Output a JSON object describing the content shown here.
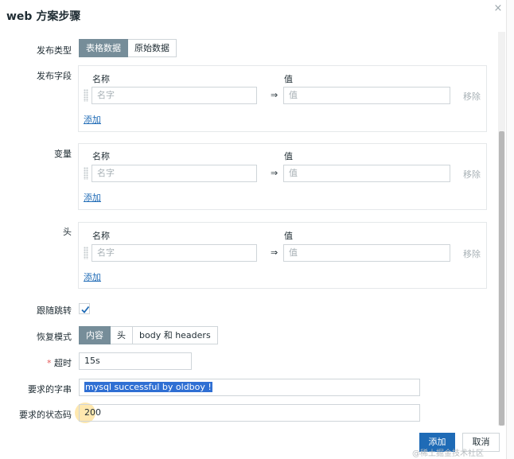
{
  "dialog": {
    "title": "web 方案步骤",
    "close_glyph": "×"
  },
  "post_type": {
    "label": "发布类型",
    "options": [
      "表格数据",
      "原始数据"
    ],
    "selected": "表格数据"
  },
  "post_fields": {
    "label": "发布字段",
    "name_header": "名称",
    "value_header": "值",
    "rows": [
      {
        "name_placeholder": "名字",
        "value_placeholder": "值",
        "arrow": "⇒",
        "remove": "移除"
      }
    ],
    "add": "添加"
  },
  "variables": {
    "label": "变量",
    "name_header": "名称",
    "value_header": "值",
    "rows": [
      {
        "name_placeholder": "名字",
        "value_placeholder": "值",
        "arrow": "⇒",
        "remove": "移除"
      }
    ],
    "add": "添加"
  },
  "headers": {
    "label": "头",
    "name_header": "名称",
    "value_header": "值",
    "rows": [
      {
        "name_placeholder": "名字",
        "value_placeholder": "值",
        "arrow": "⇒",
        "remove": "移除"
      }
    ],
    "add": "添加"
  },
  "follow_redirects": {
    "label": "跟随跳转",
    "checked": true
  },
  "retrieve_mode": {
    "label": "恢复模式",
    "options": [
      "内容",
      "头",
      "body 和 headers"
    ],
    "selected": "内容"
  },
  "timeout": {
    "required_mark": "*",
    "label": "超时",
    "value": "15s"
  },
  "required_string": {
    "label": "要求的字串",
    "value": "mysql successful by oldboy !"
  },
  "required_status": {
    "label": "要求的状态码",
    "value": "200"
  },
  "footer": {
    "add_button": "添加",
    "cancel_button": "取消"
  },
  "watermark": "@稀土掘金技术社区",
  "colors": {
    "primary": "#1f6bb6",
    "segment_active": "#768d99",
    "text": "#1f2c33",
    "placeholder": "#a8b1b6",
    "selection": "#2f6fd3"
  }
}
